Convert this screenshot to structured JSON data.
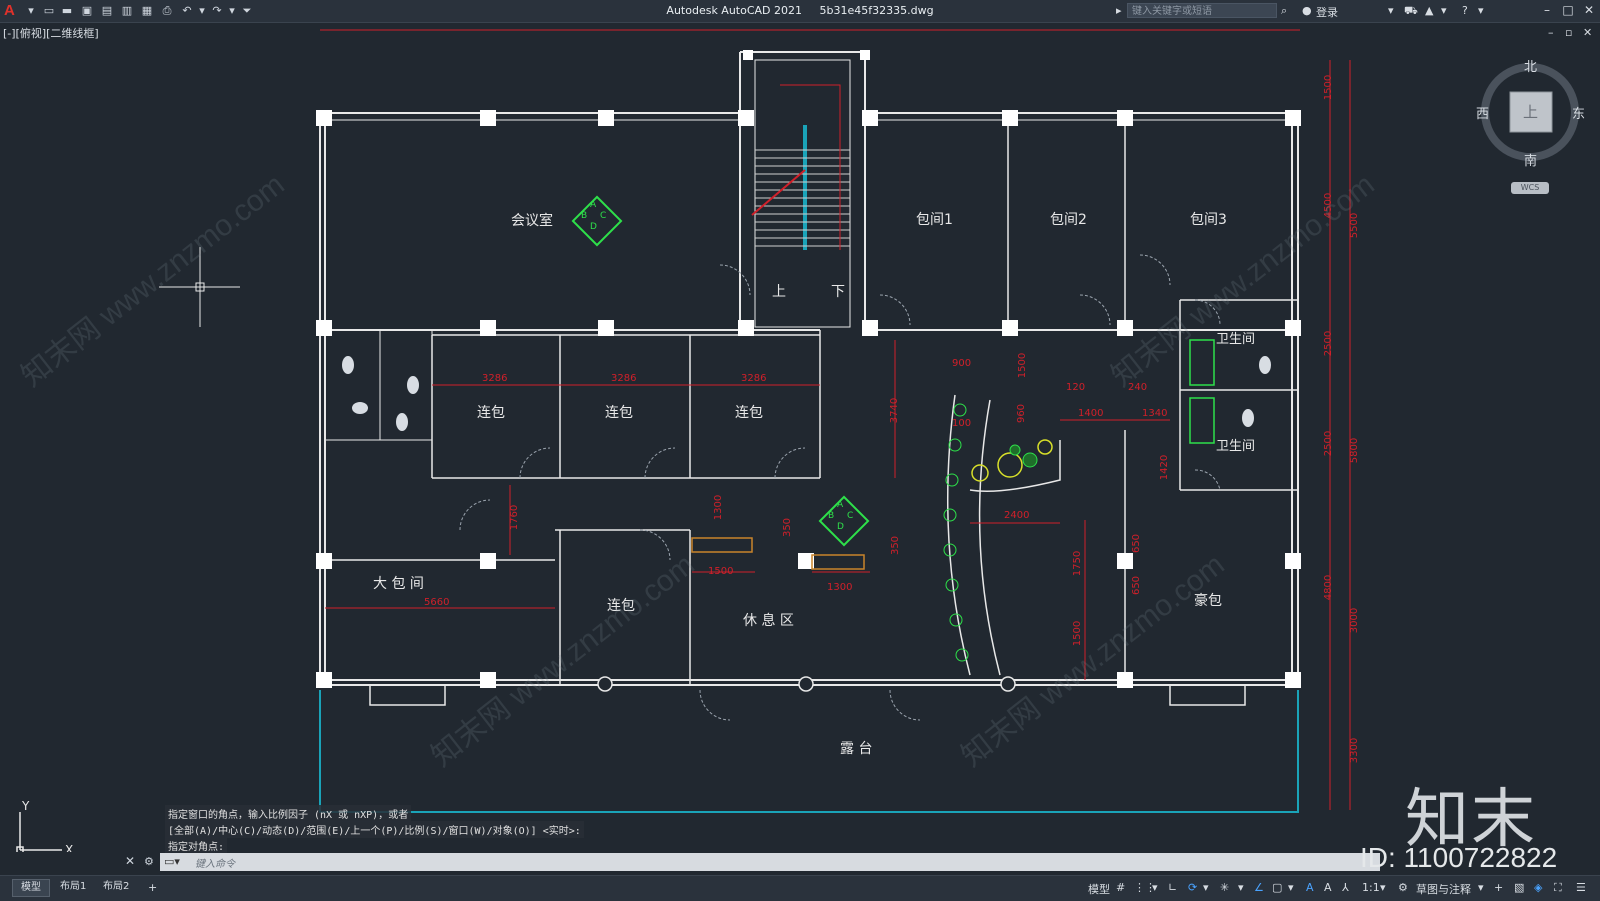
{
  "titlebar": {
    "app_name": "Autodesk AutoCAD 2021",
    "file_name": "5b31e45f32335.dwg",
    "search_placeholder": "键入关键字或短语",
    "login_label": "登录",
    "logo_letter": "A"
  },
  "viewport": {
    "label": "[-][俯视][二维线框]"
  },
  "viewcube": {
    "north": "北",
    "south": "南",
    "east": "东",
    "west": "西",
    "top_face": "上",
    "wcs": "WCS"
  },
  "rooms": {
    "meeting": "会议室",
    "private1": "包间1",
    "private2": "包间2",
    "private3": "包间3",
    "connect1": "连包",
    "connect2": "连包",
    "connect3": "连包",
    "connect4": "连包",
    "big_private": "大 包 间",
    "lounge": "休 息 区",
    "luxury": "豪包",
    "toilet1": "卫生间",
    "toilet2": "卫生间",
    "terrace": "露 台",
    "stair_up": "上",
    "stair_down": "下"
  },
  "tag": {
    "a": "A",
    "b": "B",
    "c": "C",
    "d": "D"
  },
  "dims": {
    "d1": "3286",
    "d2": "3286",
    "d3": "3286",
    "d4": "3740",
    "d5": "900",
    "d6": "1500",
    "d7": "960",
    "d8": "100",
    "d9": "120",
    "d10": "1400",
    "d11": "240",
    "d12": "1340",
    "d13": "1420",
    "d14": "2400",
    "d15": "1760",
    "d16": "1300",
    "d17": "350",
    "d18": "1500",
    "d19": "1300",
    "d20": "350",
    "d21": "5660",
    "d22": "1750",
    "d23": "1500",
    "d24": "650",
    "d25": "650",
    "r1": "1500",
    "r2": "4500",
    "r3": "5500",
    "r4": "2500",
    "r5": "2500",
    "r6": "5800",
    "r7": "4800",
    "r8": "3000",
    "r9": "3300"
  },
  "command": {
    "line1": "指定窗口的角点，输入比例因子 (nX 或 nXP)，或者",
    "line2": "[全部(A)/中心(C)/动态(D)/范围(E)/上一个(P)/比例(S)/窗口(W)/对象(O)] <实时>:",
    "line3": "指定对角点:",
    "input_placeholder": "键入命令"
  },
  "layout_tabs": [
    "模型",
    "布局1",
    "布局2"
  ],
  "status": {
    "model_label": "模型",
    "scale": "1:1",
    "workspace": "草图与注释"
  },
  "watermark": {
    "logo": "知末",
    "id": "ID: 1100722822",
    "site": "知末网 www.znzmo.com"
  },
  "colors": {
    "bg": "#212830",
    "wall": "#e8e8e8",
    "dim": "#d0202a",
    "tag": "#2ee04a",
    "glass": "#1aa3b8"
  }
}
